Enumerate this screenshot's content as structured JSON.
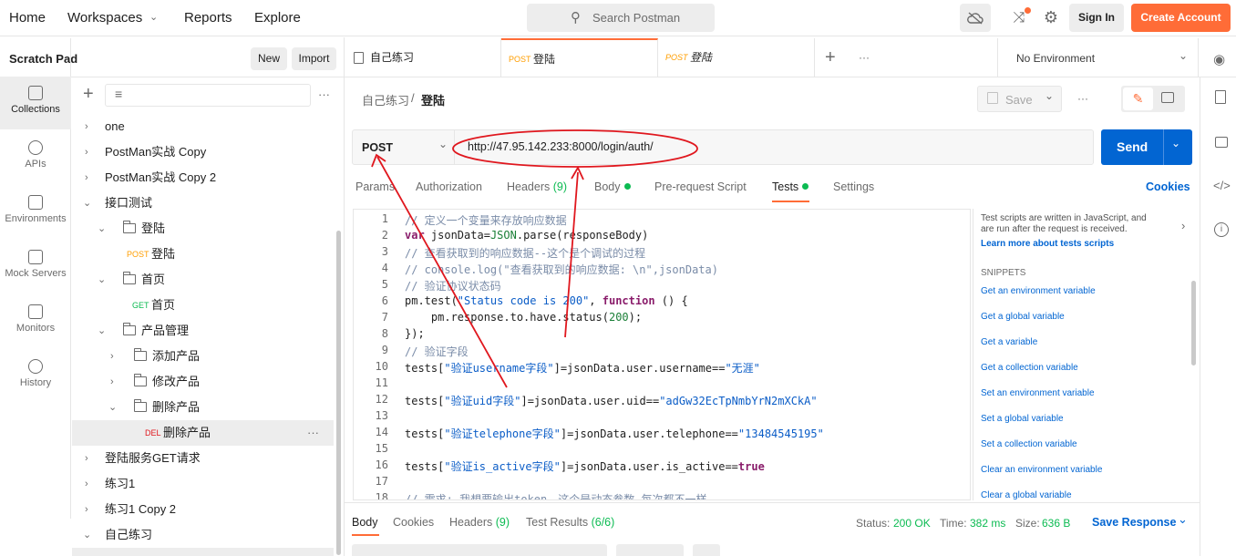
{
  "topbar": {
    "home": "Home",
    "workspaces": "Workspaces",
    "reports": "Reports",
    "explore": "Explore",
    "search_placeholder": "Search Postman",
    "sign_in": "Sign In",
    "create_account": "Create Account"
  },
  "scratch": {
    "title": "Scratch Pad",
    "new": "New",
    "import": "Import"
  },
  "rail": [
    {
      "label": "Collections"
    },
    {
      "label": "APIs"
    },
    {
      "label": "Environments"
    },
    {
      "label": "Mock Servers"
    },
    {
      "label": "Monitors"
    },
    {
      "label": "History"
    }
  ],
  "tree": [
    {
      "label": "one"
    },
    {
      "label": "PostMan实战 Copy"
    },
    {
      "label": "PostMan实战 Copy 2"
    },
    {
      "label": "接口测试"
    },
    {
      "label": "登陆"
    },
    {
      "method": "POST",
      "label": "登陆"
    },
    {
      "label": "首页"
    },
    {
      "method": "GET",
      "label": "首页"
    },
    {
      "label": "产品管理"
    },
    {
      "label": "添加产品"
    },
    {
      "label": "修改产品"
    },
    {
      "label": "删除产品"
    },
    {
      "method": "DEL",
      "label": "删除产品"
    },
    {
      "label": "登陆服务GET请求"
    },
    {
      "label": "练习1"
    },
    {
      "label": "练习1 Copy 2"
    },
    {
      "label": "自己练习"
    }
  ],
  "tabs": [
    {
      "label": "自己练习"
    },
    {
      "method": "POST",
      "label": "登陆"
    },
    {
      "method": "POST",
      "label": "登陆"
    }
  ],
  "environment": "No Environment",
  "breadcrumb": {
    "parent": "自己练习",
    "sep": "/",
    "current": "登陆"
  },
  "save": "Save",
  "request": {
    "method": "POST",
    "url": "http://47.95.142.233:8000/login/auth/",
    "send": "Send"
  },
  "subtabs": {
    "params": "Params",
    "authorization": "Authorization",
    "headers": "Headers",
    "headers_count": "(9)",
    "body": "Body",
    "prerequest": "Pre-request Script",
    "tests": "Tests",
    "settings": "Settings",
    "cookies": "Cookies"
  },
  "code": {
    "l1": "// 定义一个变量来存放响应数据",
    "l2a": "var",
    "l2b": " jsonData=",
    "l2c": "JSON",
    "l2d": ".parse(responseBody)",
    "l3": "// 查看获取到的响应数据--这个是个调试的过程",
    "l4": "// console.log(\"查看获取到的响应数据: \\n\",jsonData)",
    "l5": "// 验证协议状态码",
    "l6a": "pm.test(",
    "l6b": "\"Status code is 200\"",
    "l6c": ", ",
    "l6d": "function",
    "l6e": " () {",
    "l7a": "    pm.response.to.have.status(",
    "l7b": "200",
    "l7c": ");",
    "l8": "});",
    "l9": "// 验证字段",
    "l10a": "tests[",
    "l10b": "\"验证username字段\"",
    "l10c": "]=jsonData.user.username==",
    "l10d": "\"无涯\"",
    "l12a": "tests[",
    "l12b": "\"验证uid字段\"",
    "l12c": "]=jsonData.user.uid==",
    "l12d": "\"adGw32EcTpNmbYrN2mXCkA\"",
    "l14a": "tests[",
    "l14b": "\"验证telephone字段\"",
    "l14c": "]=jsonData.user.telephone==",
    "l14d": "\"13484545195\"",
    "l16a": "tests[",
    "l16b": "\"验证is_active字段\"",
    "l16c": "]=jsonData.user.is_active==",
    "l16d": "true",
    "l18": "// 需求: 我想要输出token，这个是动态参数 每次都不一样",
    "numbers": [
      "1",
      "2",
      "3",
      "4",
      "5",
      "6",
      "7",
      "8",
      "9",
      "10",
      "11",
      "12",
      "13",
      "14",
      "15",
      "16",
      "17",
      "18"
    ]
  },
  "help": {
    "line1": "Test scripts are written in JavaScript, and",
    "line2": "are run after the request is received.",
    "link": "Learn more about tests scripts",
    "snippets_title": "SNIPPETS"
  },
  "snippets": [
    "Get an environment variable",
    "Get a global variable",
    "Get a variable",
    "Get a collection variable",
    "Set an environment variable",
    "Set a global variable",
    "Set a collection variable",
    "Clear an environment variable",
    "Clear a global variable"
  ],
  "response": {
    "body": "Body",
    "cookies": "Cookies",
    "headers": "Headers",
    "headers_count": "(9)",
    "test_results": "Test Results",
    "test_count": "(6/6)",
    "status_label": "Status:",
    "status": "200 OK",
    "time_label": "Time:",
    "time": "382 ms",
    "size_label": "Size:",
    "size": "636 B",
    "save_response": "Save Response"
  },
  "colors": {
    "accent": "#ff6c37",
    "send": "#0265d2",
    "annotation": "#e0171e",
    "ok": "#0cbb52"
  }
}
